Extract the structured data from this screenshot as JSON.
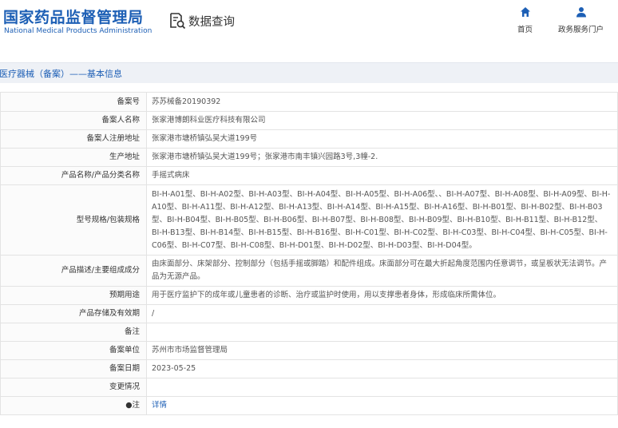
{
  "header": {
    "logo_cn": "国家药品监督管理局",
    "logo_en": "National Medical Products Administration",
    "query_label": "数据查询",
    "nav": [
      {
        "label": "首页",
        "icon": "home-icon"
      },
      {
        "label": "政务服务门户",
        "icon": "user-icon"
      }
    ]
  },
  "breadcrumb": "医疗器械（备案）——基本信息",
  "rows": [
    {
      "label": "备案号",
      "value": "苏苏械备20190392"
    },
    {
      "label": "备案人名称",
      "value": "张家港博朗科业医疗科技有限公司"
    },
    {
      "label": "备案人注册地址",
      "value": "张家港市塘桥镇弘吴大道199号"
    },
    {
      "label": "生产地址",
      "value": "张家港市塘桥镇弘吴大道199号；张家港市南丰镇兴园路3号,3幢-2."
    },
    {
      "label": "产品名称/产品分类名称",
      "value": "手摇式病床"
    },
    {
      "label": "型号规格/包装规格",
      "value": "BI-H-A01型、BI-H-A02型、BI-H-A03型、BI-H-A04型、BI-H-A05型、BI-H-A06型、、BI-H-A07型、BI-H-A08型、BI-H-A09型、BI-H-A10型、BI-H-A11型、BI-H-A12型、BI-H-A13型、BI-H-A14型、BI-H-A15型、BI-H-A16型、BI-H-B01型、BI-H-B02型、BI-H-B03型、BI-H-B04型、BI-H-B05型、BI-H-B06型、BI-H-B07型、BI-H-B08型、BI-H-B09型、BI-H-B10型、BI-H-B11型、BI-H-B12型、BI-H-B13型、BI-H-B14型、BI-H-B15型、BI-H-B16型、BI-H-C01型、BI-H-C02型、BI-H-C03型、BI-H-C04型、BI-H-C05型、BI-H-C06型、BI-H-C07型、BI-H-C08型、BI-H-D01型、BI-H-D02型、BI-H-D03型、BI-H-D04型。"
    },
    {
      "label": "产品描述/主要组成成分",
      "value": "由床面部分、床架部分、控制部分（包括手摇或脚踏）和配件组成。床面部分可在最大折起角度范围内任意调节，或呈板状无法调节。产品为无源产品。"
    },
    {
      "label": "预期用途",
      "value": "用于医疗监护下的成年或儿童患者的诊断、治疗或监护时使用，用以支撑患者身体，形成临床所需体位。"
    },
    {
      "label": "产品存储及有效期",
      "value": "/"
    },
    {
      "label": "备注",
      "value": ""
    },
    {
      "label": "备案单位",
      "value": "苏州市市场监督管理局"
    },
    {
      "label": "备案日期",
      "value": "2023-05-25"
    },
    {
      "label": "变更情况",
      "value": ""
    },
    {
      "label": "●注",
      "value": "详情",
      "link": true
    }
  ]
}
